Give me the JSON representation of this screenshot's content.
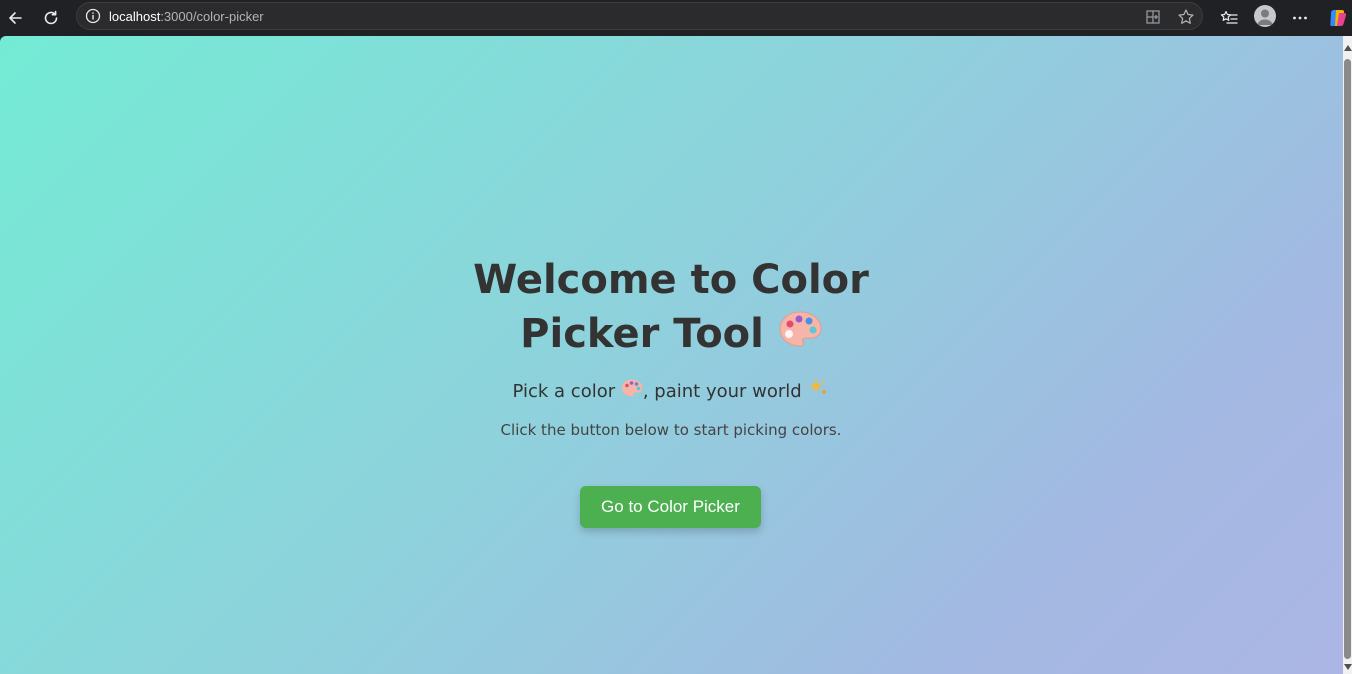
{
  "browser": {
    "url_host": "localhost",
    "url_path": ":3000/color-picker",
    "icons": [
      "back-icon",
      "reload-icon",
      "site-info-icon",
      "split-screen-icon",
      "favorite-star-icon",
      "favorites-list-icon",
      "profile-avatar-icon",
      "more-menu-icon",
      "copilot-icon"
    ]
  },
  "page": {
    "title_line1": "Welcome to Color",
    "title_line2": "Picker Tool",
    "title_emoji": "🎨",
    "tagline_part1": "Pick a color ",
    "tagline_emoji1": "🎨",
    "tagline_part2": ", paint your world ",
    "tagline_emoji2": "✨",
    "instruction": "Click the button below to start picking colors.",
    "button_label": "Go to Color Picker"
  },
  "colors": {
    "gradient_start": "#74ebd5",
    "gradient_end": "#acb6e5",
    "button_bg": "#4caf50",
    "text": "#333333"
  }
}
